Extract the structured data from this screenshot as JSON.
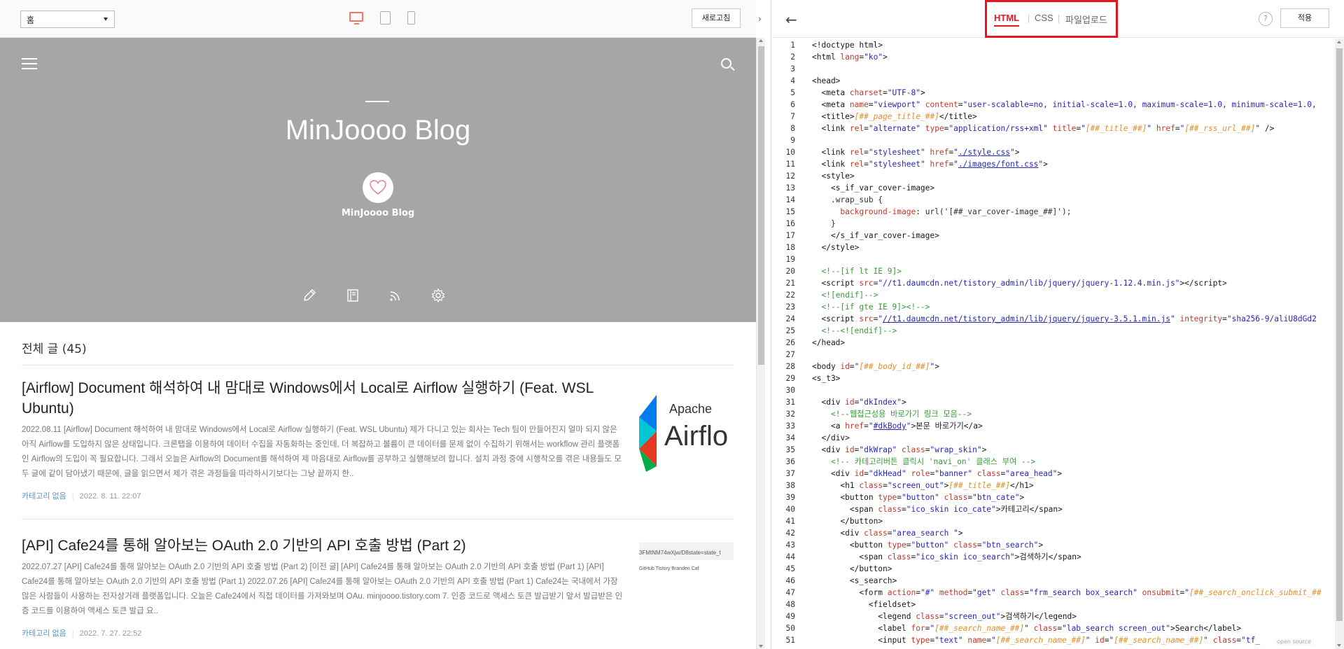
{
  "preview": {
    "page_select": "홈",
    "refresh_label": "새로고침",
    "collapse_glyph": "›",
    "hero": {
      "title": "MinJoooo Blog",
      "name": "MinJoooo Blog"
    },
    "count_label": "전체 글 (45)",
    "posts": [
      {
        "title": "[Airflow] Document 해석하여 내 맘대로 Windows에서 Local로 Airflow 실행하기 (Feat. WSL Ubuntu)",
        "excerpt": "2022.08.11 [Airflow] Document 해석하여 내 맘대로 Windows에서 Local로 Airflow 실행하기 (Feat. WSL Ubuntu) 제가 다니고 있는 회사는 Tech 팀이 만들어진지 얼마 되지 않은 아직 Airflow를 도입하지 않은 상태입니다. 크론탭을 이용하여 데이터 수집을 자동화하는 중인데, 더 복잡하고 볼륨이 큰 데이터를 문제 없이 수집하기 위해서는 workflow 관리 플랫폼인 Airflow의 도입이 꼭 필요합니다. 그래서 오늘은 Airflow의 Document를 해석하여 제 마음대로 Airflow를 공부하고 실행해보려 합니다. 설치 과정 중에 시행착오를 겪은 내용들도 모두 글에 같이 담아냈기 때문에, 글을 읽으면서 제가 겪은 과정들을 따라하시기보다는 그냥 끝까지 한..",
        "category": "카테고리 없음",
        "date": "2022. 8. 11. 22:07",
        "thumb_text_1": "Apache",
        "thumb_text_2": "Airflo"
      },
      {
        "title": "[API] Cafe24를 통해 알아보는 OAuth 2.0 기반의 API 호출 방법 (Part 2)",
        "excerpt": "2022.07.27 [API] Cafe24를 통해 알아보는 OAuth 2.0 기반의 API 호출 방법 (Part 2) [이전 글] [API] Cafe24를 통해 알아보는 OAuth 2.0 기반의 API 호출 방법 (Part 1) [API] Cafe24를 통해 알아보는 OAuth 2.0 기반의 API 호출 방법 (Part 1) 2022.07.26 [API] Cafe24를 통해 알아보는 OAuth 2.0 기반의 API 호출 방법 (Part 1) Cafe24는 국내에서 가장 많은 사람들이 사용하는 전자상거래 플랫폼입니다. 오늘은 Cafe24에서 직접 데이터를 가져와보며 OAu. minjoooo.tistory.com 7. 인증 코드로 액세스 토큰 발급받기 앞서 발급받은 인증 코드를 이용하여 액세스 토큰 발급 요..",
        "category": "카테고리 없음",
        "date": "2022. 7. 27. 22:52",
        "thumb_text_1": "3FMtNM74wXjw/D8state=state_t",
        "thumb_text_2": "GitHub   Tistory   Branden   Caf"
      }
    ]
  },
  "editor": {
    "tabs": [
      "HTML",
      "CSS",
      "파일업로드"
    ],
    "help_label": "?",
    "apply_label": "적용",
    "back_glyph": "←",
    "opensource_label": "open source"
  },
  "colors": {
    "accent_red": "#e4161f",
    "hero_gray": "#a6a6a6",
    "desktop_icon": "#f0786a"
  }
}
